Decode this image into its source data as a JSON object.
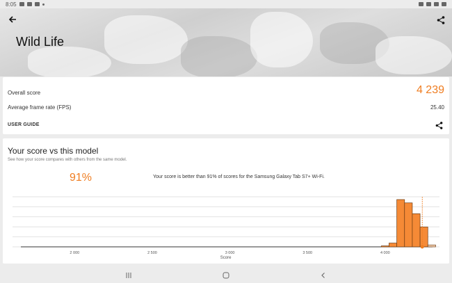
{
  "status_bar": {
    "time": "8:05"
  },
  "header": {
    "title": "Wild Life"
  },
  "score_card": {
    "overall_label": "Overall score",
    "overall_value": "4 239",
    "fps_label": "Average frame rate (FPS)",
    "fps_value": "25.40",
    "user_guide_label": "USER GUIDE"
  },
  "comparison": {
    "title": "Your score vs this model",
    "subtitle": "See how your score compares with others from the same model.",
    "percent": "91%",
    "statement": "Your score is better than 91% of scores for the Samsung Galaxy Tab S7+ Wi-Fi."
  },
  "colors": {
    "accent": "#ef7d21",
    "bar_fill": "#f58a36",
    "bar_light": "#fbd7b8"
  },
  "chart_data": {
    "type": "bar",
    "xlabel": "Score",
    "xlim": [
      1600,
      4350
    ],
    "ticks": [
      "2 000",
      "2 500",
      "3 000",
      "3 500",
      "4 000"
    ],
    "tick_values": [
      2000,
      2500,
      3000,
      3500,
      4000
    ],
    "user_score": 4239,
    "bins": [
      {
        "x0": 3975,
        "x1": 4025,
        "value": 2
      },
      {
        "x0": 4025,
        "x1": 4075,
        "value": 8
      },
      {
        "x0": 4075,
        "x1": 4125,
        "value": 100
      },
      {
        "x0": 4125,
        "x1": 4175,
        "value": 93
      },
      {
        "x0": 4175,
        "x1": 4225,
        "value": 70
      },
      {
        "x0": 4225,
        "x1": 4275,
        "value": 42
      },
      {
        "x0": 4275,
        "x1": 4325,
        "value": 4
      }
    ]
  }
}
